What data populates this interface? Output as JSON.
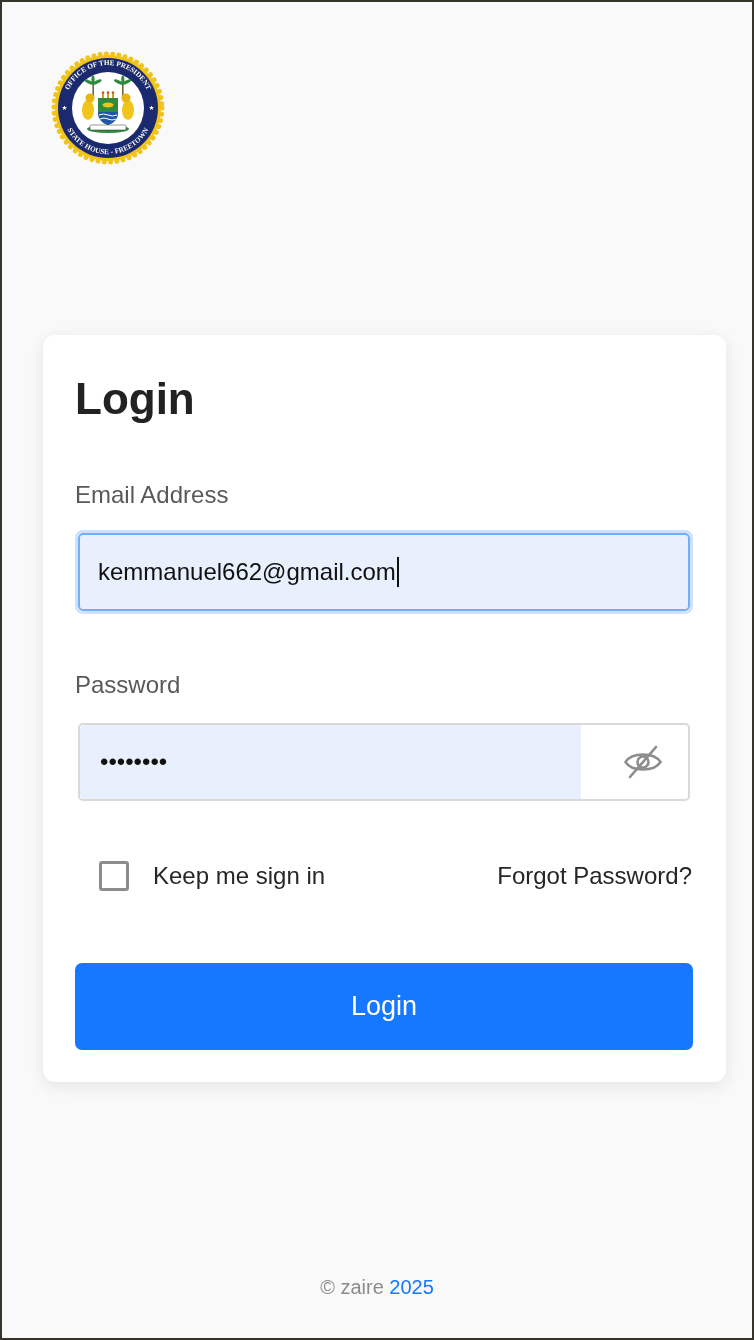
{
  "logo": {
    "top_text": "OFFICE OF THE PRESIDENT",
    "bottom_text": "STATE HOUSE - FREETOWN"
  },
  "login_form": {
    "title": "Login",
    "fields": [
      {
        "kind": "email",
        "label": "Email Address",
        "value": "kemmanuel662@gmail.com",
        "focused": true,
        "autofilled": true
      },
      {
        "kind": "password",
        "label": "Password",
        "value": "••••••••",
        "focused": false,
        "autofilled": true,
        "visible": false
      }
    ],
    "remember": {
      "label": "Keep me sign in",
      "checked": false
    },
    "forgot_link": "Forgot Password?",
    "submit": "Login"
  },
  "footer": {
    "text": "© zaire",
    "link": "2025"
  }
}
